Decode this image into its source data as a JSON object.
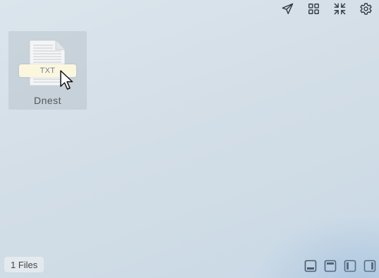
{
  "toolbar": {
    "buttons": [
      {
        "icon": "send-icon"
      },
      {
        "icon": "grid-icon"
      },
      {
        "icon": "collapse-icon"
      },
      {
        "icon": "gear-icon"
      }
    ]
  },
  "files": [
    {
      "name": "Dnest",
      "type_label": "TXT"
    }
  ],
  "status": {
    "count_label": "1 Files"
  },
  "layout_buttons": [
    {
      "icon": "dock-bottom-icon"
    },
    {
      "icon": "dock-top-icon"
    },
    {
      "icon": "dock-left-icon"
    },
    {
      "icon": "dock-right-icon"
    }
  ],
  "colors": {
    "background": "#d5e0e8",
    "icon": "#2f3b47",
    "badge": "#fbf7df"
  }
}
